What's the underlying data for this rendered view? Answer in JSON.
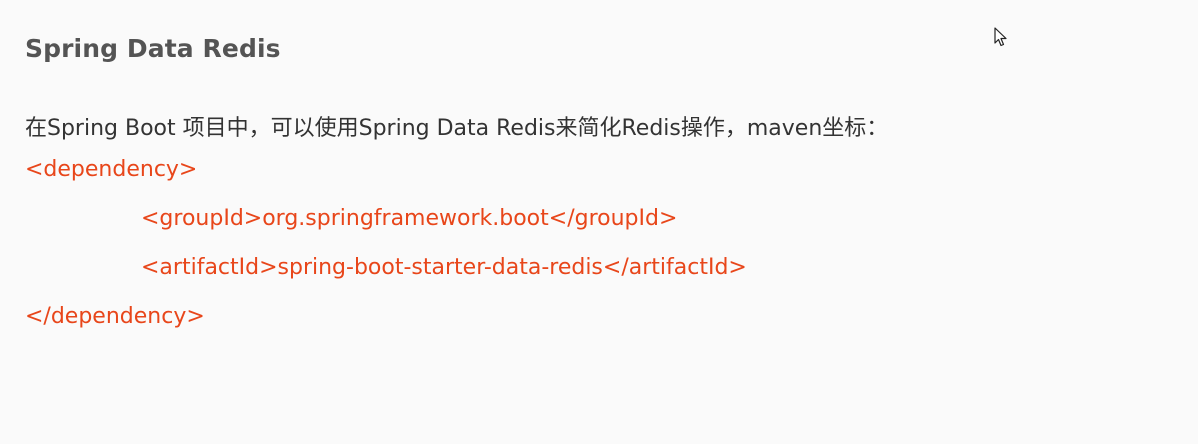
{
  "slide": {
    "title": "Spring Data Redis",
    "intro": "在Spring Boot 项目中，可以使用Spring Data Redis来简化Redis操作，maven坐标：",
    "code": {
      "line1": "<dependency>",
      "line2": "<groupId>org.springframework.boot</groupId>",
      "line3": "<artifactId>spring-boot-starter-data-redis</artifactId>",
      "line4": "</dependency>"
    }
  },
  "colors": {
    "title": "#545454",
    "body_text": "#333333",
    "code": "#e8461a",
    "background": "#fafafa"
  },
  "icons": {
    "cursor": "mouse-pointer-icon"
  }
}
